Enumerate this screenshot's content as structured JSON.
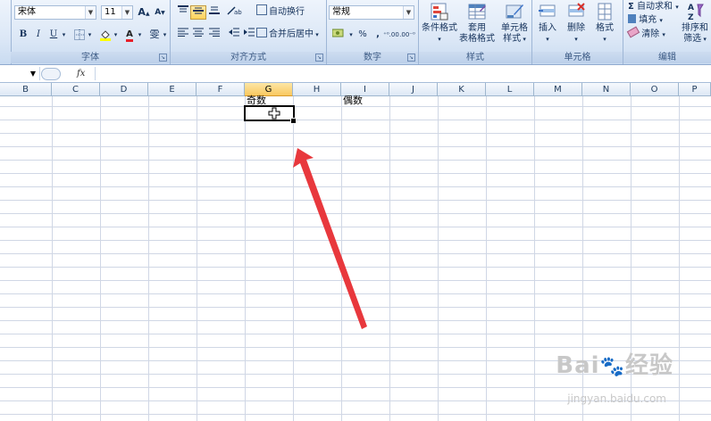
{
  "ribbon": {
    "font": {
      "font_name": "宋体",
      "font_size": "11",
      "grow_font": "A",
      "shrink_font": "A",
      "bold": "B",
      "italic": "I",
      "underline": "U",
      "font_color_glyph": "A",
      "phonetic_glyph": "雯",
      "label": "字体"
    },
    "alignment": {
      "wrap_text": "自动换行",
      "merge_center": "合并后居中",
      "label": "对齐方式"
    },
    "number": {
      "format": "常规",
      "percent": "%",
      "comma": ",",
      "increase_decimal": "⁺⁰.00",
      "decrease_decimal": ".00⁻⁰",
      "label": "数字"
    },
    "styles": {
      "conditional_formatting": "条件格式",
      "format_as_table_line1": "套用",
      "format_as_table_line2": "表格格式",
      "cell_styles_line1": "单元格",
      "cell_styles_line2": "样式",
      "label": "样式"
    },
    "cells": {
      "insert": "插入",
      "delete": "删除",
      "format": "格式",
      "label": "单元格"
    },
    "editing": {
      "autosum": "自动求和",
      "fill": "填充",
      "clear": "清除",
      "sort_line1": "排序和",
      "sort_line2": "筛选",
      "label": "编辑"
    }
  },
  "formula_bar": {
    "fx": "fx"
  },
  "columns": [
    "B",
    "C",
    "D",
    "E",
    "F",
    "G",
    "H",
    "I",
    "J",
    "K",
    "L",
    "M",
    "N",
    "O",
    "P"
  ],
  "selected_column": "G",
  "cells": {
    "g1": "奇数",
    "i1": "偶数"
  },
  "watermark": {
    "brand": "Bai",
    "brand_cn": "经验",
    "url": "jingyan.baidu.com"
  },
  "colors": {
    "arrow": "#e8383d",
    "selected_header": "#f9c85f",
    "ribbon_bg": "#dbe7f6"
  }
}
